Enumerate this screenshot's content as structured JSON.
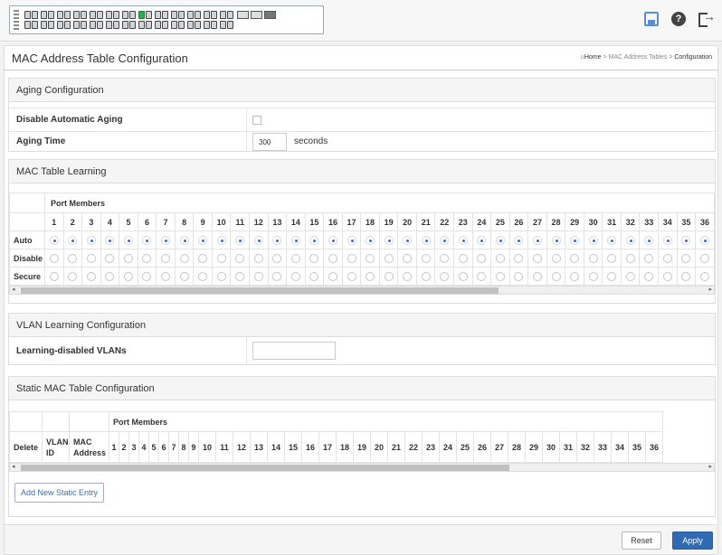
{
  "page_title": "MAC Address Table Configuration",
  "breadcrumb": {
    "home": "Home",
    "sep": ">",
    "mid": "MAC Address Tables",
    "current": "Configuration"
  },
  "aging": {
    "title": "Aging Configuration",
    "disable_label": "Disable Automatic Aging",
    "disable_checked": false,
    "time_label": "Aging Time",
    "time_value": "300",
    "time_unit": "seconds"
  },
  "learning": {
    "title": "MAC Table Learning",
    "port_members": "Port Members",
    "rows": [
      "Auto",
      "Disable",
      "Secure"
    ],
    "selected": "Auto",
    "ports": [
      "1",
      "2",
      "3",
      "4",
      "5",
      "6",
      "7",
      "8",
      "9",
      "10",
      "11",
      "12",
      "13",
      "14",
      "15",
      "16",
      "17",
      "18",
      "19",
      "20",
      "21",
      "22",
      "23",
      "24",
      "25",
      "26",
      "27",
      "28",
      "29",
      "30",
      "31",
      "32",
      "33",
      "34",
      "35",
      "36"
    ]
  },
  "vlan": {
    "title": "VLAN Learning Configuration",
    "label": "Learning-disabled VLANs",
    "value": ""
  },
  "static": {
    "title": "Static MAC Table Configuration",
    "port_members": "Port Members",
    "col_delete": "Delete",
    "col_vlan": "VLAN ID",
    "col_mac": "MAC Address",
    "ports": [
      "1",
      "2",
      "3",
      "4",
      "5",
      "6",
      "7",
      "8",
      "9",
      "10",
      "11",
      "12",
      "13",
      "14",
      "15",
      "16",
      "17",
      "18",
      "19",
      "20",
      "21",
      "22",
      "23",
      "24",
      "25",
      "26",
      "27",
      "28",
      "29",
      "30",
      "31",
      "32",
      "33",
      "34",
      "35",
      "36"
    ],
    "add_button": "Add New Static Entry"
  },
  "buttons": {
    "reset": "Reset",
    "apply": "Apply"
  },
  "icons": {
    "save": "save-icon",
    "help": "help-icon",
    "logout": "logout-icon"
  },
  "colors": {
    "accent": "#2f6ab3",
    "link": "#3a6fb0",
    "port_active": "#25b14c"
  }
}
